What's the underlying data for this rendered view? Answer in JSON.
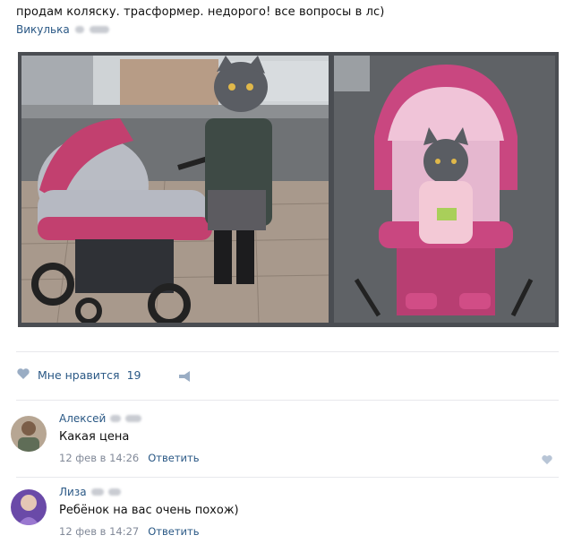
{
  "post": {
    "text": "продам коляску. трасформер. недорого! все вопросы в лс)",
    "author": "Викулька"
  },
  "icons": {
    "like": "heart-icon",
    "share": "megaphone-share-icon",
    "comment_like": "heart-icon"
  },
  "likes": {
    "label": "Мне нравится",
    "count": "19"
  },
  "comments": [
    {
      "name": "Алексей",
      "text": "Какая цена",
      "date": "12 фев в 14:26",
      "reply": "Ответить"
    },
    {
      "name": "Лиза",
      "text": "Ребёнок на вас очень похож)",
      "date": "12 фев в 14:27",
      "reply": "Ответить"
    }
  ],
  "colors": {
    "link": "#2a5885",
    "meta": "#828a99",
    "stroller_pink": "#c2406f",
    "stroller_gray": "#b9bcc4"
  }
}
